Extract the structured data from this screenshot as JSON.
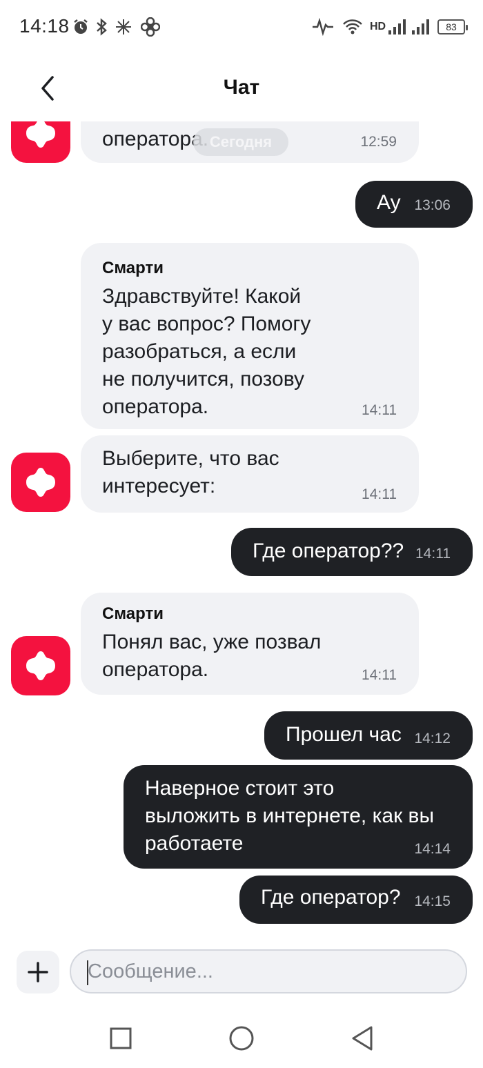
{
  "status_bar": {
    "time": "14:18",
    "network": "HD",
    "battery": "83"
  },
  "header": {
    "title": "Чат"
  },
  "chat": {
    "date_divider": "Сегодня",
    "messages": [
      {
        "direction": "in",
        "text": "оператора.",
        "time": "12:59"
      },
      {
        "direction": "out",
        "text": "Ау",
        "time": "13:06"
      },
      {
        "direction": "in",
        "sender": "Смарти",
        "text": "Здравствуйте! Какой\nу вас вопрос? Помогу\nразобраться, а если\nне получится, позову\nоператора.",
        "time": "14:11"
      },
      {
        "direction": "in",
        "text": "Выберите, что вас\nинтересует:",
        "time": "14:11"
      },
      {
        "direction": "out",
        "text": "Где оператор??",
        "time": "14:11"
      },
      {
        "direction": "in",
        "sender": "Смарти",
        "text": "Понял вас, уже позвал\nоператора.",
        "time": "14:11"
      },
      {
        "direction": "out",
        "text": "Прошел час",
        "time": "14:12"
      },
      {
        "direction": "out",
        "text": "Наверное стоит это\nвыложить в интернете, как вы\nработаете",
        "time": "14:14"
      },
      {
        "direction": "out",
        "text": "Где оператор?",
        "time": "14:15"
      }
    ]
  },
  "composer": {
    "placeholder": "Сообщение...",
    "value": ""
  },
  "colors": {
    "brand": "#f4123f",
    "outgoing_bubble": "#1f2125",
    "incoming_bubble": "#f1f2f5"
  },
  "icons": [
    "chevron-left-icon",
    "plus-icon",
    "square-icon",
    "circle-icon",
    "triangle-back-icon",
    "smarti-logo"
  ]
}
